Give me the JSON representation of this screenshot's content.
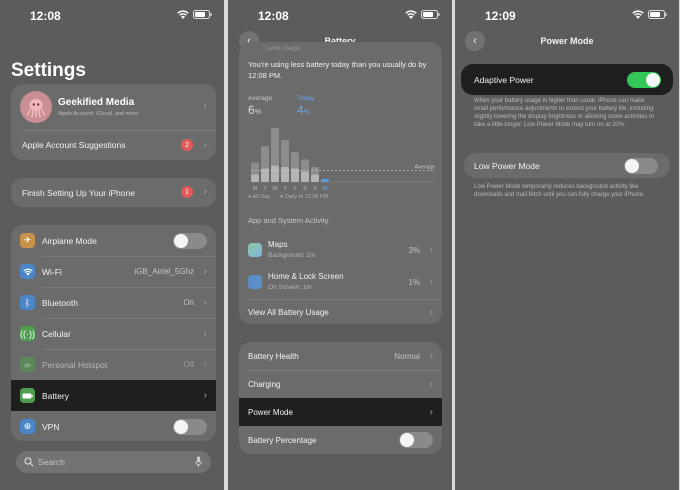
{
  "screen1": {
    "time": "12:08",
    "title": "Settings",
    "profile": {
      "name": "Geekified Media",
      "subtitle": "Apple Account, iCloud, and more"
    },
    "suggestions": {
      "label": "Apple Account Suggestions",
      "badge": "2"
    },
    "finish_setup": {
      "label": "Finish Setting Up Your iPhone",
      "badge": "1"
    },
    "items": [
      {
        "label": "Airplane Mode",
        "value": ""
      },
      {
        "label": "Wi-Fi",
        "value": "iGB_Airtel_5Ghz"
      },
      {
        "label": "Bluetooth",
        "value": "On"
      },
      {
        "label": "Cellular",
        "value": ""
      },
      {
        "label": "Personal Hotspot",
        "value": "Off"
      },
      {
        "label": "Battery",
        "value": ""
      },
      {
        "label": "VPN",
        "value": ""
      }
    ],
    "search_placeholder": "Search",
    "colors": {
      "airplane": "#c8914a",
      "wifi": "#4a86c8",
      "bluetooth": "#4a86c8",
      "cellular": "#4f9e4f",
      "hotspot": "#4f9e4f",
      "battery": "#4f9e4f",
      "vpn": "#4a86c8"
    }
  },
  "screen2": {
    "time": "12:08",
    "nav_title": "Battery",
    "cut_header": "Level Usage",
    "message": "You're using less battery today than you usually do by 12:08 PM.",
    "average_label": "Average",
    "average_value": "6",
    "today_label": "Today",
    "today_value": "4",
    "percent": "%",
    "average_line_label": "Average",
    "chart_data": {
      "type": "bar",
      "categories": [
        "M",
        "T",
        "W",
        "T",
        "F",
        "S",
        "S",
        "M"
      ],
      "series": [
        {
          "name": "All Day",
          "values": [
            26,
            48,
            72,
            56,
            40,
            30,
            20,
            0
          ]
        },
        {
          "name": "Daily to 12:08 PM",
          "values": [
            10,
            18,
            22,
            20,
            18,
            14,
            10,
            4
          ]
        }
      ],
      "average": 6,
      "ylim": [
        0,
        80
      ]
    },
    "legend": [
      "All Day",
      "Daily to 12:08 PM"
    ],
    "activity_header": "App and System Activity",
    "apps": [
      {
        "name": "Maps",
        "detail": "Background: 1m",
        "value": "3%"
      },
      {
        "name": "Home & Lock Screen",
        "detail": "On Screen: 1m",
        "value": "1%"
      }
    ],
    "view_all": "View All Battery Usage",
    "settings": [
      {
        "label": "Battery Health",
        "value": "Normal"
      },
      {
        "label": "Charging",
        "value": ""
      },
      {
        "label": "Power Mode",
        "value": ""
      },
      {
        "label": "Battery Percentage",
        "value": ""
      }
    ]
  },
  "screen3": {
    "time": "12:09",
    "nav_title": "Power Mode",
    "adaptive_label": "Adaptive Power",
    "adaptive_desc": "When your battery usage is higher than usual, iPhone can make small performance adjustments to extend your battery life, including slightly lowering the display brightness or allowing some activities to take a little longer. Low Power Mode may turn on at 20%.",
    "low_power_label": "Low Power Mode",
    "low_power_desc": "Low Power Mode temporarily reduces background activity like downloads and mail fetch until you can fully charge your iPhone."
  }
}
